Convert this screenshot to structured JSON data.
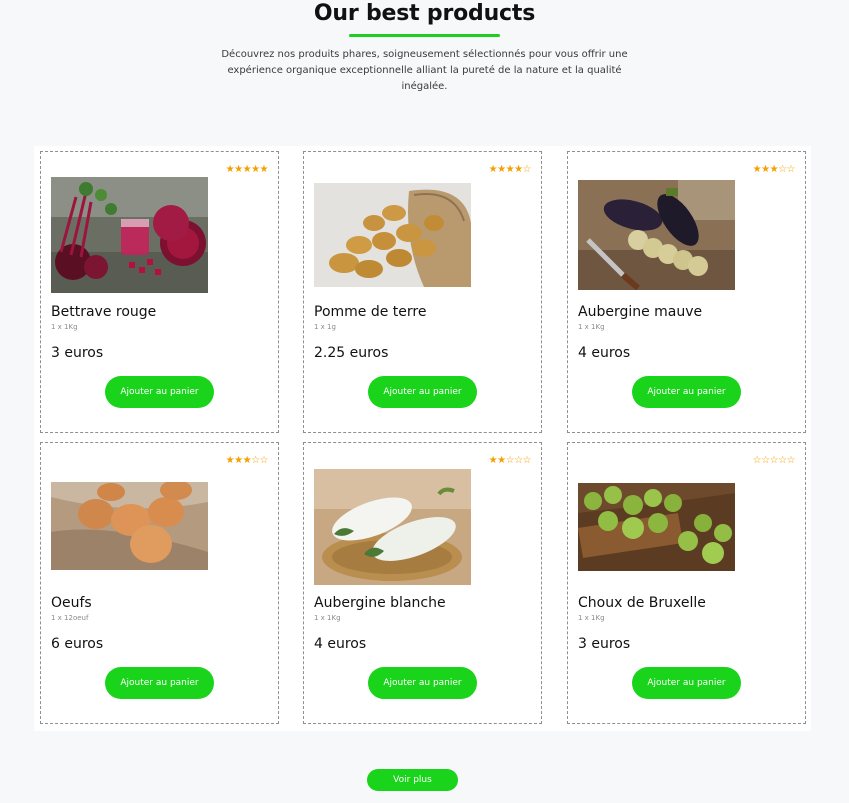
{
  "header": {
    "title": "Our best products",
    "subtitle": "Découvrez nos produits phares, soigneusement sélectionnés pour vous offrir une expérience organique exceptionnelle alliant la pureté de la nature et la qualité inégalée."
  },
  "colors": {
    "accent": "#19d41b",
    "star": "#f5a000"
  },
  "products": [
    {
      "name": "Bettrave rouge",
      "unit": "1 x 1Kg",
      "price": "3 euros",
      "rating": 5,
      "button": "Ajouter au panier",
      "image": "beetroot-photo"
    },
    {
      "name": "Pomme de terre",
      "unit": "1 x 1g",
      "price": "2.25 euros",
      "rating": 4,
      "button": "Ajouter au panier",
      "image": "potatoes-photo"
    },
    {
      "name": "Aubergine mauve",
      "unit": "1 x 1Kg",
      "price": "4 euros",
      "rating": 3,
      "button": "Ajouter au panier",
      "image": "eggplant-photo"
    },
    {
      "name": "Oeufs",
      "unit": "1 x 12oeuf",
      "price": "6 euros",
      "rating": 3,
      "button": "Ajouter au panier",
      "image": "eggs-photo"
    },
    {
      "name": "Aubergine blanche",
      "unit": "1 x 1Kg",
      "price": "4 euros",
      "rating": 2,
      "button": "Ajouter au panier",
      "image": "white-eggplant-photo"
    },
    {
      "name": "Choux de Bruxelle",
      "unit": "1 x 1Kg",
      "price": "3 euros",
      "rating": 0,
      "button": "Ajouter au panier",
      "image": "brussels-sprouts-photo"
    }
  ],
  "footer": {
    "more_label": "Voir plus"
  }
}
